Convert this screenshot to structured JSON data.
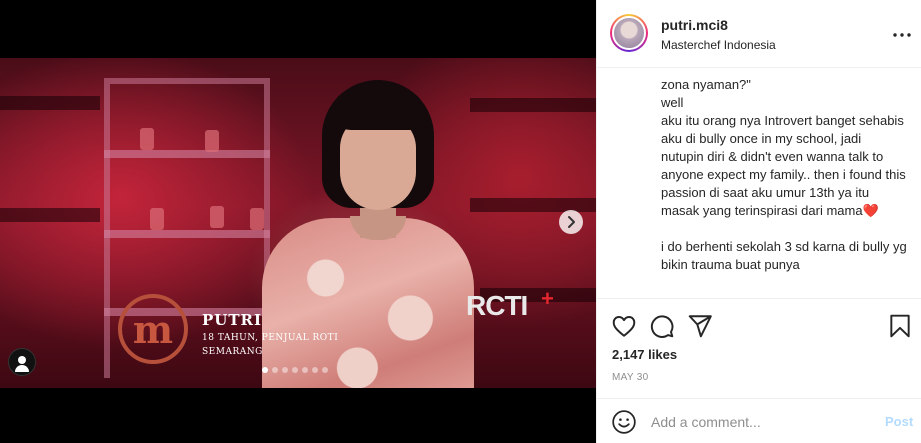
{
  "post": {
    "username": "putri.mci8",
    "location": "Masterchef Indonesia",
    "more_label": "•••"
  },
  "media": {
    "overlay_name": "PUTRI",
    "overlay_detail": "18 TAHUN, PENJUAL ROTI",
    "overlay_city": "SEMARANG",
    "logo_letter": "m",
    "channel_logo": "RCTI",
    "channel_plus": "+",
    "next_icon": "chevron-right-icon",
    "carousel_count": 7,
    "carousel_active": 0
  },
  "caption": {
    "text": "zona nyaman?\"\nwell\naku itu orang nya Introvert banget sehabis aku di bully once in my school, jadi nutupin diri & didn't even wanna talk to anyone expect my family.. then i found this passion di saat aku umur 13th ya itu masak yang terinspirasi dari mama❤️\n\ni do berhenti sekolah 3 sd karna di bully yg bikin trauma buat punya"
  },
  "actions": {
    "like_icon": "heart-icon",
    "comment_icon": "comment-icon",
    "share_icon": "share-icon",
    "save_icon": "bookmark-icon",
    "likes_text": "2,147 likes",
    "date_text": "MAY 30"
  },
  "comment": {
    "placeholder": "Add a comment...",
    "post_label": "Post",
    "emoji_icon": "smiley-icon"
  },
  "colors": {
    "post_button": "#b3dbff",
    "story_ring": "#ee2a7b",
    "text": "#262626",
    "secondary_text": "#8e8e8e"
  }
}
